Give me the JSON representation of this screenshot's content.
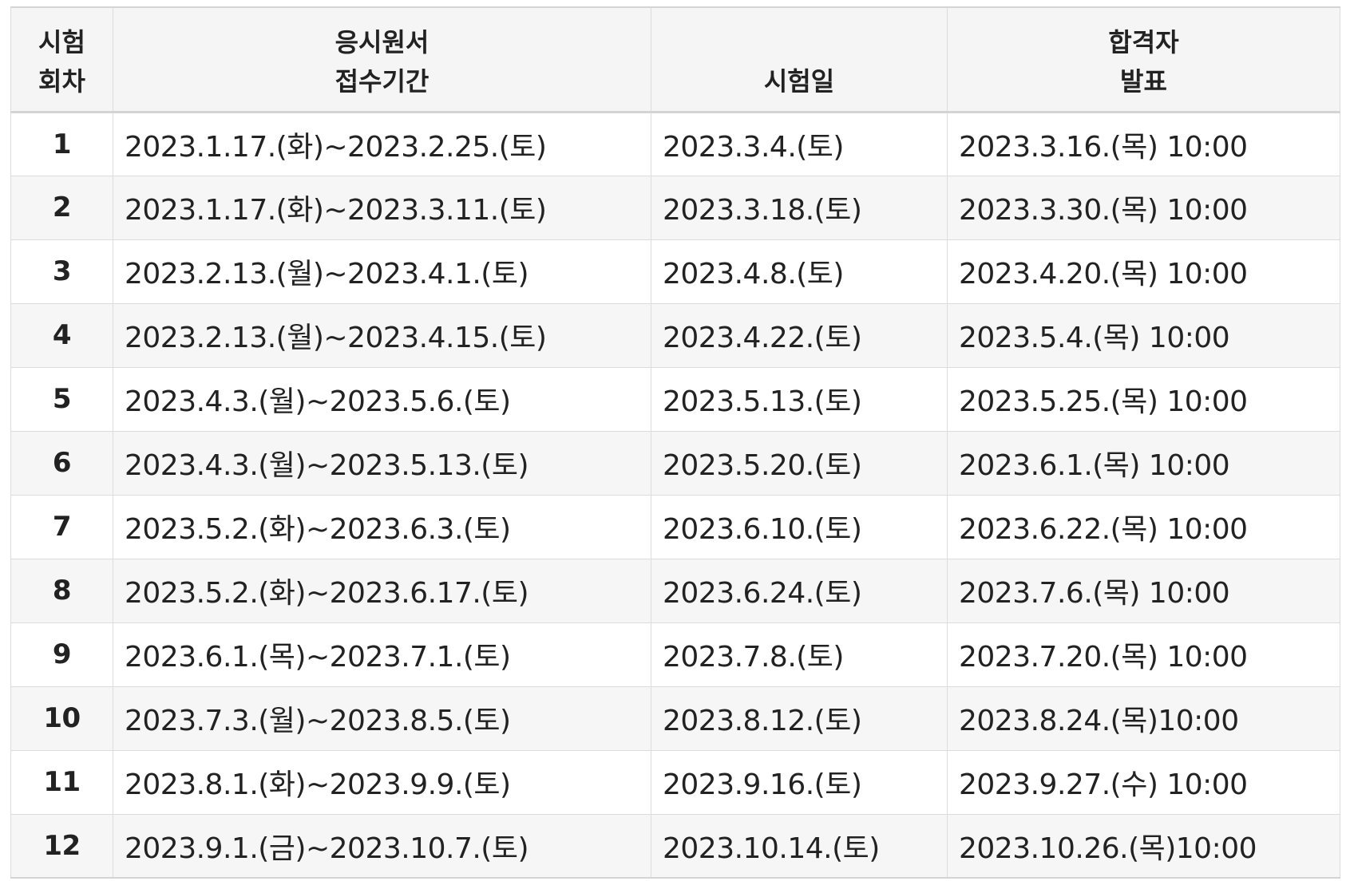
{
  "header": {
    "round": [
      "시험",
      "회차"
    ],
    "application": [
      "응시원서",
      "접수기간"
    ],
    "exam_date": [
      "",
      "시험일"
    ],
    "announcement": [
      "합격자",
      "발표"
    ]
  },
  "rows": [
    {
      "round": "1",
      "application": "2023.1.17.(화)~2023.2.25.(토)",
      "exam_date": "2023.3.4.(토)",
      "announcement": "2023.3.16.(목) 10:00"
    },
    {
      "round": "2",
      "application": "2023.1.17.(화)~2023.3.11.(토)",
      "exam_date": "2023.3.18.(토)",
      "announcement": "2023.3.30.(목) 10:00"
    },
    {
      "round": "3",
      "application": "2023.2.13.(월)~2023.4.1.(토)",
      "exam_date": "2023.4.8.(토)",
      "announcement": "2023.4.20.(목) 10:00"
    },
    {
      "round": "4",
      "application": "2023.2.13.(월)~2023.4.15.(토)",
      "exam_date": "2023.4.22.(토)",
      "announcement": "2023.5.4.(목) 10:00"
    },
    {
      "round": "5",
      "application": "2023.4.3.(월)~2023.5.6.(토)",
      "exam_date": "2023.5.13.(토)",
      "announcement": "2023.5.25.(목) 10:00"
    },
    {
      "round": "6",
      "application": "2023.4.3.(월)~2023.5.13.(토)",
      "exam_date": "2023.5.20.(토)",
      "announcement": "2023.6.1.(목) 10:00"
    },
    {
      "round": "7",
      "application": "2023.5.2.(화)~2023.6.3.(토)",
      "exam_date": "2023.6.10.(토)",
      "announcement": "2023.6.22.(목) 10:00"
    },
    {
      "round": "8",
      "application": "2023.5.2.(화)~2023.6.17.(토)",
      "exam_date": "2023.6.24.(토)",
      "announcement": "2023.7.6.(목) 10:00"
    },
    {
      "round": "9",
      "application": "2023.6.1.(목)~2023.7.1.(토)",
      "exam_date": "2023.7.8.(토)",
      "announcement": "2023.7.20.(목) 10:00"
    },
    {
      "round": "10",
      "application": "2023.7.3.(월)~2023.8.5.(토)",
      "exam_date": "2023.8.12.(토)",
      "announcement": "2023.8.24.(목)10:00"
    },
    {
      "round": "11",
      "application": "2023.8.1.(화)~2023.9.9.(토)",
      "exam_date": "2023.9.16.(토)",
      "announcement": "2023.9.27.(수) 10:00"
    },
    {
      "round": "12",
      "application": "2023.9.1.(금)~2023.10.7.(토)",
      "exam_date": "2023.10.14.(토)",
      "announcement": "2023.10.26.(목)10:00"
    }
  ]
}
